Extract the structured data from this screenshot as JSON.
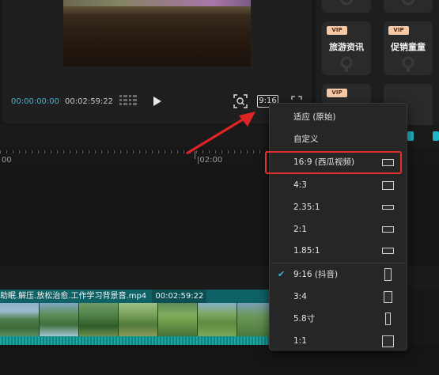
{
  "player": {
    "current_time": "00:00:00:00",
    "total_time": "00:02:59:22",
    "ratio_label": "9:16"
  },
  "templates": {
    "cards": [
      {
        "badge": "VIP",
        "label": "旅游资讯"
      },
      {
        "badge": "VIP",
        "label": "促销童童"
      },
      {
        "badge": "VIP",
        "label": ""
      }
    ]
  },
  "timeline": {
    "ticks": [
      "00",
      "|02:00"
    ],
    "clip_name": "助眠.解压.放松治愈.工作学习背景音.mp4",
    "clip_duration": "00:02:59:22"
  },
  "aspect_menu": {
    "items": [
      {
        "label": "适应 (原始)",
        "checked": false
      },
      {
        "label": "自定义",
        "checked": false
      },
      {
        "label": "16:9 (西瓜视频)",
        "checked": false,
        "highlighted": true
      },
      {
        "label": "4:3",
        "checked": false
      },
      {
        "label": "2.35:1",
        "checked": false
      },
      {
        "label": "2:1",
        "checked": false
      },
      {
        "label": "1.85:1",
        "checked": false
      },
      {
        "label": "9:16 (抖音)",
        "checked": true
      },
      {
        "label": "3:4",
        "checked": false
      },
      {
        "label": "5.8寸",
        "checked": false
      },
      {
        "label": "1:1",
        "checked": false
      }
    ],
    "check_glyph": "✔"
  },
  "colors": {
    "accent": "#3db5d6",
    "highlight_border": "#e03030",
    "clip_teal": "#0f6f73"
  }
}
